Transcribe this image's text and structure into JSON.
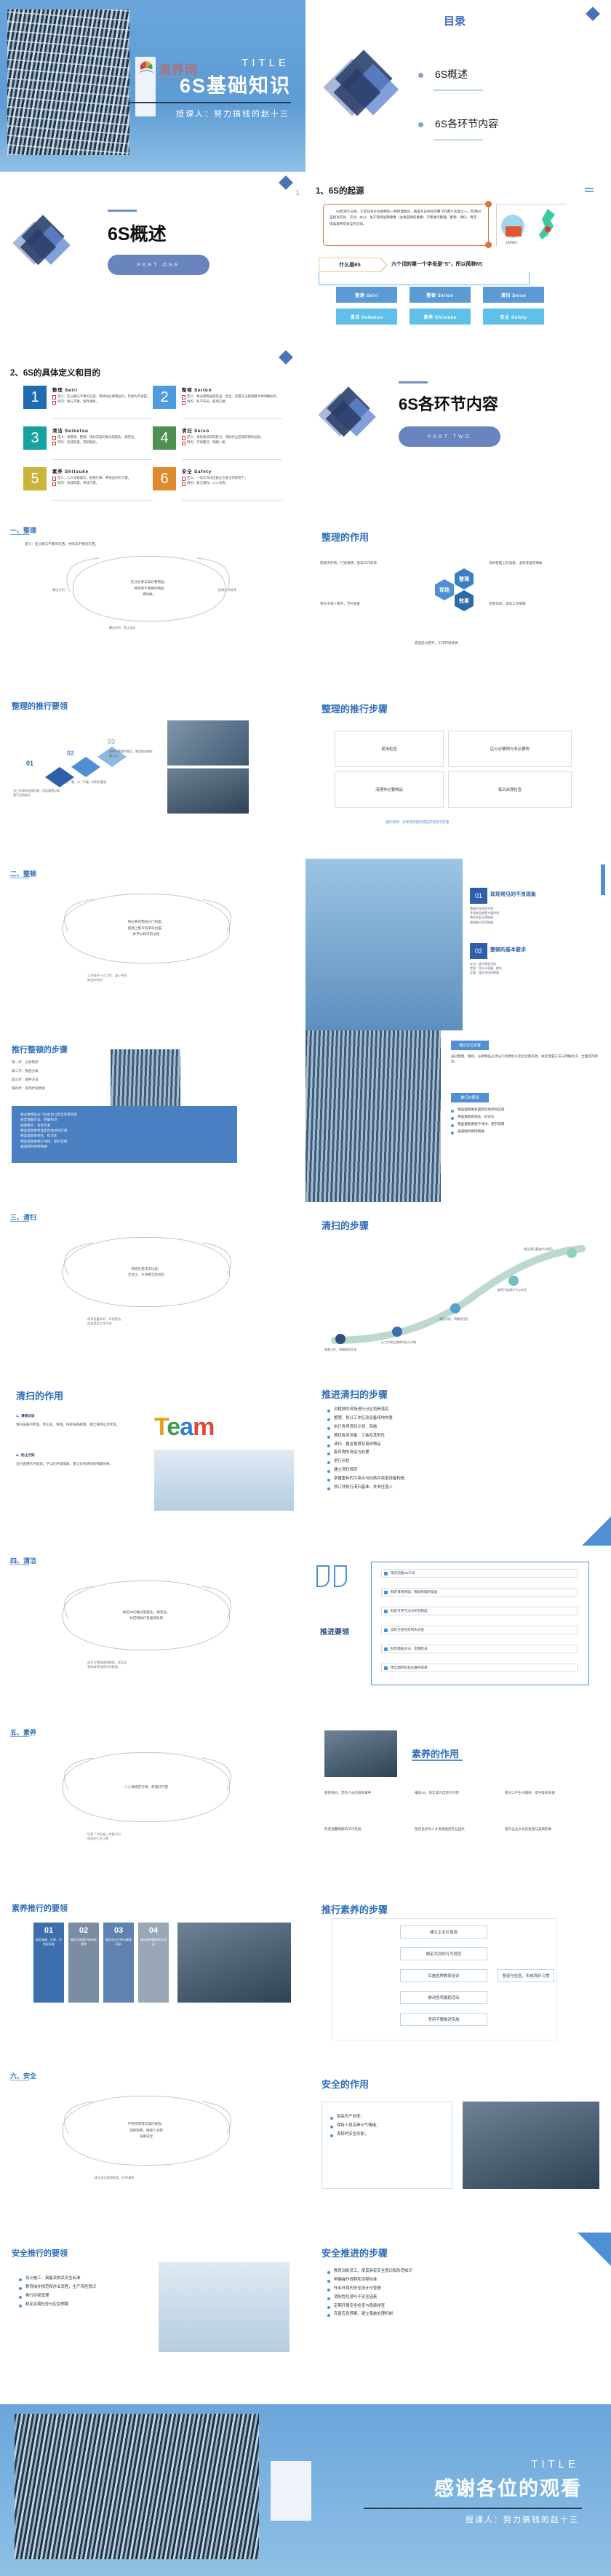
{
  "doc": {
    "title": "6S基础知识",
    "accent": "#4f8fd4",
    "accent_dark": "#2f4f7f"
  },
  "cover": {
    "title_en": "TITLE",
    "title_cn": "6S基础知识",
    "subtitle": "授课人：努力搞钱的赵十三",
    "watermark": "演界网",
    "watermark_sub": "WWW.YANJIE.COM"
  },
  "toc": {
    "heading": "目录",
    "items": [
      {
        "label": "6S概述"
      },
      {
        "label": "6S各环节内容"
      }
    ]
  },
  "part_one": {
    "title": "6S概述",
    "pill": "PART ONE"
  },
  "part_two": {
    "title": "6S各环节内容",
    "pill": "PART TWO"
  },
  "origin": {
    "heading": "1、6S的起源",
    "paragraph": "6S起源于日本，它是日本企业独特的一种管理模式，被誉为日本经济腾飞的两大法宝之一。所谓6S是指对实验、实训、办公、生产现场运用要素（主要是物的要素）不断进行整理、整顿、清扫、清洁、提高素养及安全的活动。",
    "highlight_1": "6S",
    "highlight_2": "管理模式",
    "whatis_label": "什么是6S",
    "whatis_text": "六个词的第一个字母是“S”，所以简称6S",
    "cells": [
      {
        "label": "整理 Seiri",
        "color": "#5b9bd5"
      },
      {
        "label": "整顿 Seiton",
        "color": "#5b9bd5"
      },
      {
        "label": "清扫 Seiso",
        "color": "#5b9bd5"
      },
      {
        "label": "清洁 Seiketsu",
        "color": "#5fc0e8"
      },
      {
        "label": "素养 Shitsuke",
        "color": "#5fc0e8"
      },
      {
        "label": "安全 Safety",
        "color": "#5fc0e8"
      }
    ]
  },
  "definitions": {
    "heading": "2、6S的具体定义和目的",
    "cards": [
      {
        "num": "1",
        "color": "#1f6cb0",
        "title": "整理  Seiri",
        "def": "定义：区分要与不要的东西，现场除必要物品外，其他均不放置。",
        "goal": "目的：要与不要，留弃果断。"
      },
      {
        "num": "2",
        "color": "#4f9bdc",
        "title": "整顿  Seiton",
        "def": "定义：将必要物品按定品、定位、定量方法摆放整齐并明确标示。",
        "goal": "目的：科学布局，取用方便。"
      },
      {
        "num": "3",
        "color": "#17a2a2",
        "title": "清洁  Seiketsu",
        "def": "定义：将整理、整顿、清扫实施的做法制度化、规范化。",
        "goal": "目的：形成制度，贯彻到底。"
      },
      {
        "num": "4",
        "color": "#4f8f4f",
        "title": "清扫  Seiso",
        "def": "定义：清除现场内的脏污、清除作业区域的物料垃圾。",
        "goal": "目的：环境整洁，明朗一新。"
      },
      {
        "num": "5",
        "color": "#c8b53a",
        "title": "素养  Shitsuke",
        "def": "定义：人人按章操作、依规行事，养成良好的习惯。",
        "goal": "目的：形成制度，养成习惯。"
      },
      {
        "num": "6",
        "color": "#e08a2e",
        "title": "安全  Safety",
        "def": "定义：一切工作均应建立在安全的前提下。",
        "goal": "目的：安全操作，人人有责。"
      }
    ]
  },
  "seiri": {
    "heading": "一、整理",
    "def_label": "定义：区分要与不要的东西，并除去不要的东西。",
    "bubble": "区分必要与非必要物品，\n将现场不需要的物品\n清除掉。",
    "tag_left": "腾出空间",
    "tag_right": "提高工作效率",
    "effect_title": "整理的作用",
    "effect_hex": [
      "现场",
      "整理",
      "效果"
    ],
    "effect_items": [
      "现场无杂物，行道通畅，提高工作效率",
      "消除管理上的混放、混料等差错事故",
      "有利于减少库存，节约资金",
      "改变作风，提高工作情绪"
    ],
    "effect_note": "变混乱为整齐，工作环境清爽",
    "key_title": "整理的推行要领",
    "key_items": [
      {
        "no": "01",
        "text": "对工作场所全面检查，包括看得见和看不见的地方"
      },
      {
        "no": "02",
        "text": "制定「要」与「不要」的判别基准"
      },
      {
        "no": "03",
        "text": "清除不需要的物品，制定废弃物处理方法"
      }
    ],
    "steps_title": "整理的推行步骤",
    "steps": [
      "现场检查",
      "区分必要物与非必要物",
      "清理非必要物品",
      "每天自我检查"
    ],
    "steps_note": "推行要领：对现场保留的物品实施定点定量"
  },
  "seiton": {
    "heading": "二、整顿",
    "bubble": "将必要的物品分门别类，\n摆放上整齐有序的位置，\n并予以标识的过程",
    "tag_left": "工作效率一目了然、减少寻找\n物品的时间",
    "steps_title": "推行整顿的步骤",
    "steps": [
      "第一步：分析现状",
      "第二步：物品分类",
      "第三步：储存方法",
      "第四步：贯彻贮存原则"
    ],
    "listA_title": "通过定位定置",
    "listA": [
      "将必要物品分门别类加以定位定量存放",
      "规定放置方法、明确标识",
      "摆放整齐、有条不紊"
    ],
    "note_title": "注意事项",
    "note_body": "通过整理、整顿，必要物品必须分门别类加以定位定量存放，规定放置方法与明确标识，全面贯彻到位。",
    "listB_title": "推行的要领",
    "listB": [
      "物品摆放要有固定的地点和区域",
      "物品摆放目视化、标识化",
      "物品摆放要便于寻找、便于取用",
      "通道随时保持畅通"
    ],
    "card1_no": "01",
    "card1_title": "现场常见的不良现象",
    "card1_items": [
      "需要的东西找不到",
      "寻找物品耗费大量时间",
      "物品杂乱无章堆放",
      "通道被占用不畅通"
    ],
    "card2_no": "02",
    "card2_title": "整顿的基本要求",
    "card2_items": [
      "定点：放在哪里合适",
      "定容：用什么容器、颜色",
      "定量：规定合适的数量"
    ]
  },
  "seiso": {
    "heading": "三、清扫",
    "bubble": "将岗位变成无垃圾、\n无灰尘、干净整洁的地方",
    "tag": "保持设备良好、环境整洁、\n创造良好工作环境",
    "steps_title": "清扫的步骤",
    "steps": [
      "准备工作，明确责任区域",
      "从工作岗位清除垃圾与污物",
      "清扫点检、明确责任区",
      "查明污染源并予以杜绝",
      "建立清扫基准作为规范"
    ],
    "effect_title": "清扫的作用",
    "effect_1_title": "1、清除垃圾",
    "effect_1_body": "清扫设备的死角、积尘处、管线，排除设备故障，使之保持正常状态。",
    "effect_2_title": "2、防止污染",
    "effect_2_body": "对已查明的污染源，予以杜绝或隔离，使之达到清扫的预期效果。",
    "team_word": "Team",
    "push_title": "推进清扫的步骤",
    "push_items": [
      "对粗放的现场进行分区划责落实",
      "整理、划分工作区及设备场地布置",
      "执行各项清扫计划、实施",
      "擦拭各类设备、工装及其附件",
      "清扫、搬运易燃及易碎物品",
      "废弃物的清运与处理",
      "进行点检",
      "建立清扫规范",
      "掌握重新的污染点与杜绝并改善设备构造",
      "修订并执行清扫基准，并责任落入"
    ]
  },
  "seiketsu": {
    "heading": "四、清洁",
    "bubble": "将前3S的做法制度化、规范化，\n并贯彻执行及维持效果",
    "tag": "成为习惯和规章制度，是企业\n整体改善和提升的基础",
    "key_title": "推进要领",
    "key_items": [
      "落实前面3S工作",
      "制定目视管理、看板管理的基准",
      "制定考评方法与奖惩制度",
      "高阶主管经常带头巡查",
      "制定稽核办法、定期检查",
      "用全面的标准化维持成果"
    ],
    "effect_title": "素养的作用",
    "effect_cells": [
      "教育培训，塑造人员的基本素养",
      "推动4S、落实成为自觉的习惯",
      "使员工产生归属感、提升集体荣誉",
      "形成温馨明朗的工作氛围",
      "塑造良好的人才资源促成专业团队",
      "提升企业文化的氛围与品牌形象"
    ]
  },
  "shitsuke": {
    "heading": "五、素养",
    "bubble": "人人按规定行事，养成好习惯",
    "tag": "培养「守标准」的意识与\n良好的工作习惯",
    "key_title": "素养推行的要领",
    "key_cards": [
      {
        "no": "01",
        "text": "制定服装、仪容、识别证标准"
      },
      {
        "no": "02",
        "text": "制定共同遵守的有关规则"
      },
      {
        "no": "03",
        "text": "制定礼仪守则与教育培训"
      },
      {
        "no": "04",
        "text": "推动各种精神提升活动"
      }
    ],
    "steps_title": "推行素养的步骤",
    "steps": [
      "建立企业价值观",
      "制定共同的行为规范",
      "实施各种教育培训",
      "推动各项激励活动",
      "坚持不懈推进实施"
    ],
    "branch_right": "督促与检查，形成良好习惯"
  },
  "safety": {
    "heading": "六、安全",
    "bubble": "严格贯彻落实操作规程，\n消除隐患，确保人身和\n设备安全",
    "tag": "建立安全管理制度、杜绝事故",
    "key_title": "安全推行的要领",
    "key_items": [
      "设计施工、具备及相关安全标准",
      "教育操作规范和作业流程，生产风险意识",
      "推行目视管理",
      "制定定期检查与应急预案"
    ],
    "effect_title": "安全的作用",
    "effect_items": [
      "提高先产效率；",
      "保持人员高昂士气情绪；",
      "良好的安全形象；"
    ],
    "steps_title": "安全推进的步骤",
    "steps": [
      "教育训练员工，使其具有安全意识和防范知识",
      "明确操作规程和流程标准",
      "作业环境的安全设计与管理",
      "消除危险源与不安全因素",
      "定期开展安全检查与隐患排查",
      "完善应急预案，建立事故处理机制"
    ]
  },
  "closing": {
    "title_en": "TITLE",
    "title_cn": "感谢各位的观看",
    "subtitle": "授课人：努力搞钱的赵十三"
  }
}
